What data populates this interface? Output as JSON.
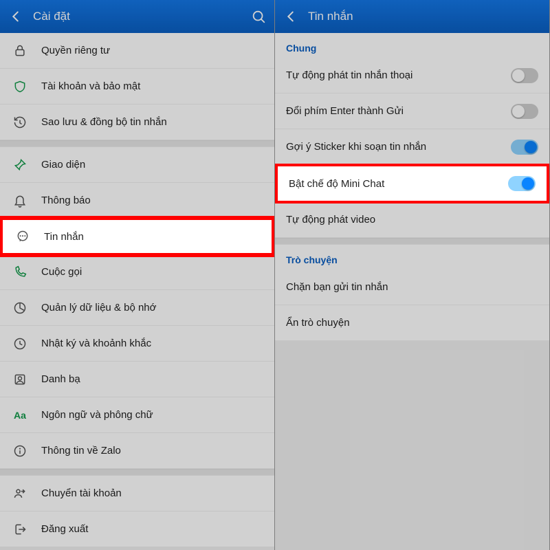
{
  "left": {
    "title": "Cài đặt",
    "groups": [
      {
        "items": [
          {
            "id": "privacy",
            "icon": "lock-icon",
            "label": "Quyền riêng tư"
          },
          {
            "id": "account",
            "icon": "shield-icon",
            "label": "Tài khoản và bảo mật"
          },
          {
            "id": "backup",
            "icon": "history-icon",
            "label": "Sao lưu & đồng bộ tin nhắn"
          }
        ]
      },
      {
        "items": [
          {
            "id": "theme",
            "icon": "pin-icon",
            "label": "Giao diện"
          },
          {
            "id": "notify",
            "icon": "bell-icon",
            "label": "Thông báo"
          },
          {
            "id": "messages",
            "icon": "chat-icon",
            "label": "Tin nhắn",
            "highlight": true
          },
          {
            "id": "calls",
            "icon": "phone-icon",
            "label": "Cuộc gọi"
          },
          {
            "id": "data",
            "icon": "pie-icon",
            "label": "Quản lý dữ liệu & bộ nhớ"
          },
          {
            "id": "diary",
            "icon": "clock-icon",
            "label": "Nhật ký và khoảnh khắc"
          },
          {
            "id": "contacts",
            "icon": "contact-icon",
            "label": "Danh bạ"
          },
          {
            "id": "font",
            "icon": "aa-icon",
            "label": "Ngôn ngữ và phông chữ"
          },
          {
            "id": "about",
            "icon": "info-icon",
            "label": "Thông tin về Zalo"
          }
        ]
      },
      {
        "items": [
          {
            "id": "switch",
            "icon": "switch-user-icon",
            "label": "Chuyển tài khoản"
          },
          {
            "id": "logout",
            "icon": "logout-icon",
            "label": "Đăng xuất"
          }
        ]
      }
    ]
  },
  "right": {
    "title": "Tin nhắn",
    "sections": [
      {
        "label": "Chung",
        "rows": [
          {
            "id": "autovoice",
            "label": "Tự động phát tin nhắn thoại",
            "toggle": "off"
          },
          {
            "id": "entersend",
            "label": "Đổi phím Enter thành Gửi",
            "toggle": "off"
          },
          {
            "id": "sticker",
            "label": "Gợi ý Sticker khi soạn tin nhắn",
            "toggle": "on"
          },
          {
            "id": "minichat",
            "label": "Bật chế độ Mini Chat",
            "toggle": "on",
            "highlight": true
          },
          {
            "id": "autovideo",
            "label": "Tự động phát video"
          }
        ]
      },
      {
        "label": "Trò chuyện",
        "rows": [
          {
            "id": "block",
            "label": "Chặn bạn gửi tin nhắn"
          },
          {
            "id": "hide",
            "label": "Ẩn trò chuyện"
          }
        ]
      }
    ]
  }
}
